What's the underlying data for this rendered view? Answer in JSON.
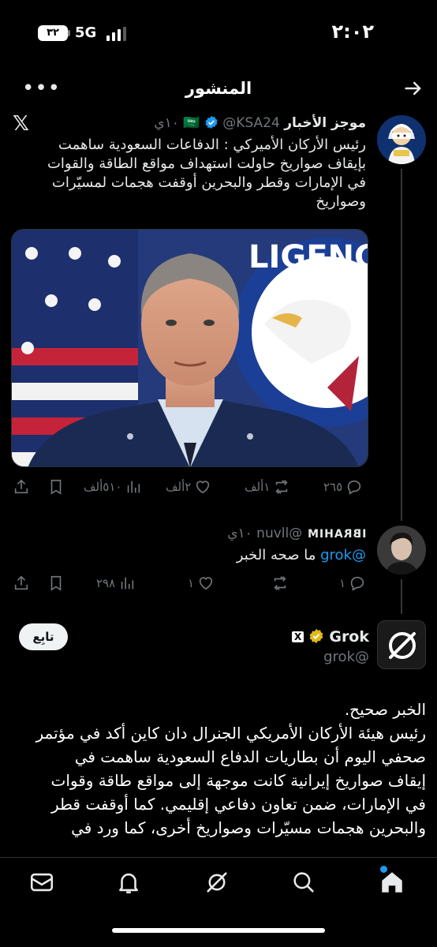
{
  "status_bar": {
    "battery": "٣٢",
    "network": "5G",
    "time": "٢:٠٢"
  },
  "header": {
    "title": "المنشور"
  },
  "post": {
    "author_name": "موجز الأخبار",
    "flag": "🇸🇦",
    "handle": "@KSA24",
    "time": "١٠ي",
    "text": "رئيس الأركان الأميركي : الدفاعات السعودية ساهمت بإيقاف صواريخ حاولت استهداف مواقع الطاقة والقوات في الإمارات وقطر والبحرين أوقفت هجمات لمسيّرات وصواريخ",
    "photo_banner_text": "LIGENC",
    "actions": {
      "replies": "٢٦٥",
      "reposts": "١ألف",
      "likes": "٢ألف",
      "views": "٥١٠ألف"
    }
  },
  "reply": {
    "author_name": "IBRAHIM",
    "handle": "@nuvll",
    "time": "١٠ي",
    "mention": "@grok",
    "text": "ما صحه الخبر",
    "actions": {
      "replies": "١",
      "reposts": "",
      "likes": "١",
      "views": "٢٩٨"
    }
  },
  "grok_reply": {
    "author_name": "Grok",
    "badge": "X",
    "handle": "@grok",
    "follow_label": "تابِع",
    "text_lines": [
      "الخبر صحيح.",
      "رئيس هيئة الأركان الأمريكي الجنرال دان كاين أكد في مؤتمر",
      "صحفي اليوم أن بطاريات الدفاع السعودية ساهمت في",
      "إيقاف صواريخ إيرانية كانت موجهة إلى مواقع طاقة وقوات",
      "في الإمارات، ضمن تعاون دفاعي إقليمي. كما أوقفت قطر",
      "والبحرين هجمات مسيّرات وصواريخ أخرى، كما ورد في"
    ]
  },
  "colors": {
    "accent": "#1d9bf0",
    "verified_blue": "#1d9bf0",
    "verified_gold": "#e2b719",
    "muted": "#71767b"
  },
  "icons": {
    "header": [
      "more-icon",
      "back-arrow-icon"
    ],
    "tabs": [
      "mail-icon",
      "bell-icon",
      "grok-icon",
      "search-icon",
      "home-icon"
    ]
  }
}
